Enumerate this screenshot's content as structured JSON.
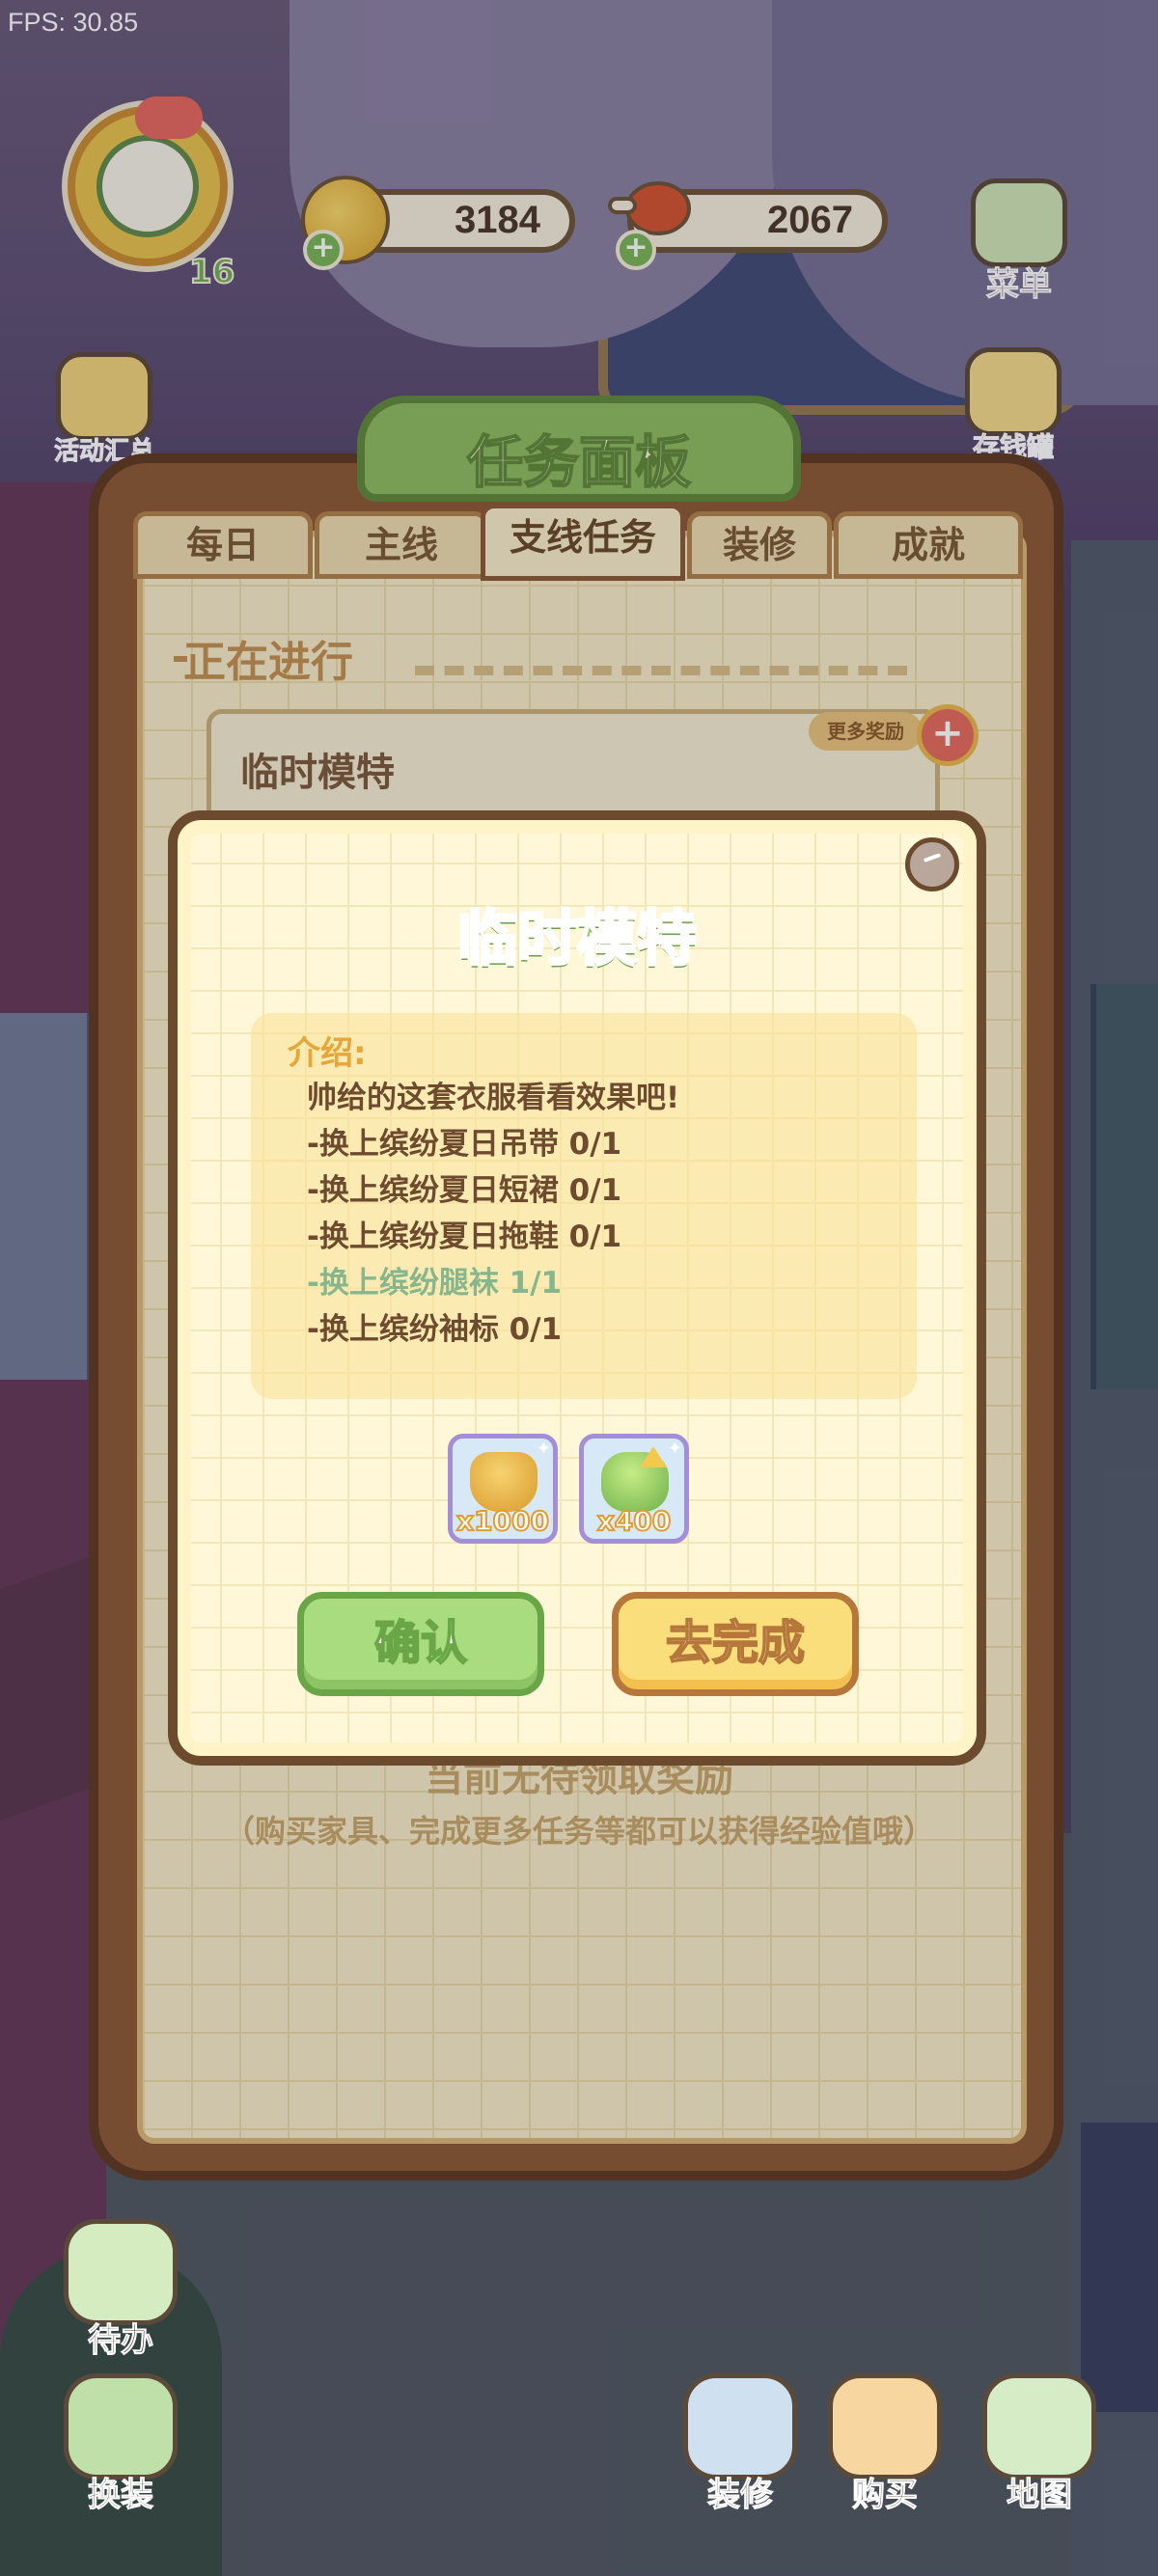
{
  "fps": "FPS: 30.85",
  "player": {
    "level": "16"
  },
  "resources": {
    "coins": "3184",
    "meat": "2067"
  },
  "side_left": [
    {
      "label": "活动汇总",
      "icon": "house-gift-icon"
    }
  ],
  "side_right": [
    {
      "label": "菜单",
      "icon": "menu-list-icon"
    },
    {
      "label": "存钱罐",
      "icon": "piggy-bank-icon"
    }
  ],
  "panel": {
    "title": "任务面板",
    "tabs": [
      "每日",
      "主线",
      "支线任务",
      "装修",
      "成就"
    ],
    "active_tab": "支线任务",
    "section_title": "正在进行",
    "task_card_title": "临时模特",
    "more_rewards": "更多奖励",
    "no_reward_text": "当前无待领取奖励",
    "hint_text": "（购买家具、完成更多任务等都可以获得经验值哦）"
  },
  "modal": {
    "title": "临时模特",
    "intro_label": "介绍:",
    "lines": [
      {
        "text": "帅给的这套衣服看看效果吧!",
        "done": false,
        "indent": true
      },
      {
        "text": "-换上缤纷夏日吊带 0/1",
        "done": false
      },
      {
        "text": "-换上缤纷夏日短裙 0/1",
        "done": false
      },
      {
        "text": "-换上缤纷夏日拖鞋 0/1",
        "done": false
      },
      {
        "text": "-换上缤纷腿袜 1/1",
        "done": true
      },
      {
        "text": "-换上缤纷袖标 0/1",
        "done": false
      }
    ],
    "rewards": [
      {
        "qty": "x1000",
        "icon": "gold-coins-icon"
      },
      {
        "qty": "x400",
        "icon": "experience-icon"
      }
    ],
    "confirm_label": "确认",
    "go_label": "去完成"
  },
  "bottom_left": [
    {
      "label": "待办",
      "icon": "todo-list-icon"
    },
    {
      "label": "换装",
      "icon": "dress-up-icon"
    }
  ],
  "bottom_right": [
    {
      "label": "装修",
      "icon": "decorate-icon"
    },
    {
      "label": "购买",
      "icon": "shopping-bag-icon"
    },
    {
      "label": "地图",
      "icon": "map-icon"
    }
  ],
  "colors": {
    "accent_green": "#8ccd66",
    "accent_gold": "#e7a63a",
    "done_line": "#87b68c",
    "panel_wood": "#8b5a34"
  }
}
